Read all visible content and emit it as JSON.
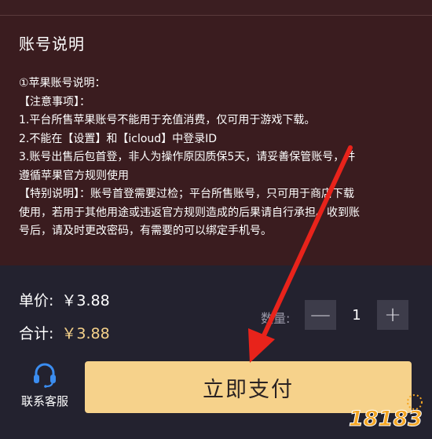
{
  "account": {
    "title": "账号说明",
    "lines": [
      "①苹果账号说明：",
      "【注意事项】：",
      "1.平台所售苹果账号不能用于充值消费，仅可用于游戏下载。",
      "2.不能在【设置】和【icloud】中登录ID",
      "3.账号出售后包首登，非人为操作原因质保5天，请妥善保管账号，并",
      "遵循苹果官方规则使用",
      "【特别说明】：账号首登需要过检；平台所售账号，只可用于商店下载",
      "使用，若用于其他用途或违返官方规则造成的后果请自行承担。收到账",
      "号后，请及时更改密码，有需要的可以绑定手机号。"
    ]
  },
  "order": {
    "unit_label": "单价:",
    "unit_price": "￥3.88",
    "total_label": "合计:",
    "total_price": "￥3.88",
    "qty_label": "数量:",
    "qty_minus": "—",
    "qty_value": "1",
    "qty_plus": "+"
  },
  "actions": {
    "service_label": "联系客服",
    "pay_label": "立即支付"
  },
  "watermark": {
    "text": "18183"
  },
  "colors": {
    "panel_bg": "#3a1c1f",
    "bar_bg": "#23222f",
    "pay_button": "#f6d28b",
    "service_icon": "#3b8df0",
    "annotation_arrow": "#e8231b"
  }
}
